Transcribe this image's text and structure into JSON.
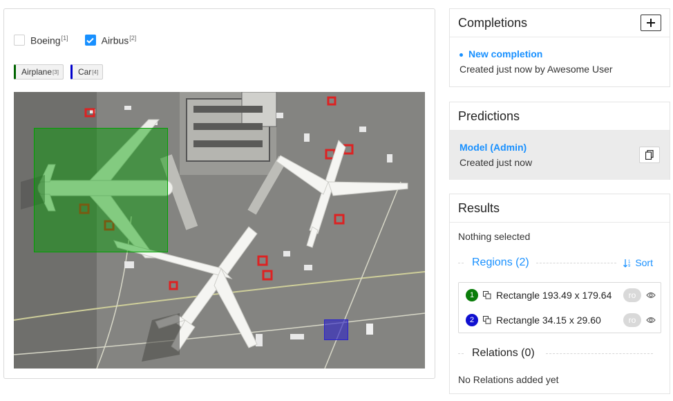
{
  "choices": [
    {
      "label": "Boeing",
      "hotkey": "[1]",
      "checked": false
    },
    {
      "label": "Airbus",
      "hotkey": "[2]",
      "checked": true
    }
  ],
  "labels": [
    {
      "label": "Airplane",
      "hotkey": "[3]",
      "color": "#006400"
    },
    {
      "label": "Car",
      "hotkey": "[4]",
      "color": "#0000cc"
    }
  ],
  "image": {
    "regions": [
      {
        "label": "Airplane",
        "color": "#00a000",
        "fill": "rgba(0,160,0,0.45)"
      },
      {
        "label": "Car",
        "color": "#2a22cc",
        "fill": "rgba(40,30,200,0.6)"
      }
    ]
  },
  "completions": {
    "title": "Completions",
    "add_label": "+",
    "item": {
      "title": "New completion",
      "subtitle": "Created just now by Awesome User"
    }
  },
  "predictions": {
    "title": "Predictions",
    "item": {
      "title": "Model (Admin)",
      "subtitle": "Created just now"
    }
  },
  "results": {
    "title": "Results",
    "nothing_selected": "Nothing selected",
    "regions_title": "Regions (2)",
    "sort_label": "Sort",
    "regions": [
      {
        "num": "1",
        "badge_color": "#0a7d0a",
        "text": "Rectangle 193.49 x 179.64",
        "ro": "ro"
      },
      {
        "num": "2",
        "badge_color": "#1010d0",
        "text": "Rectangle 34.15 x 29.60",
        "ro": "ro"
      }
    ],
    "relations_title": "Relations (0)",
    "no_relations": "No Relations added yet"
  }
}
